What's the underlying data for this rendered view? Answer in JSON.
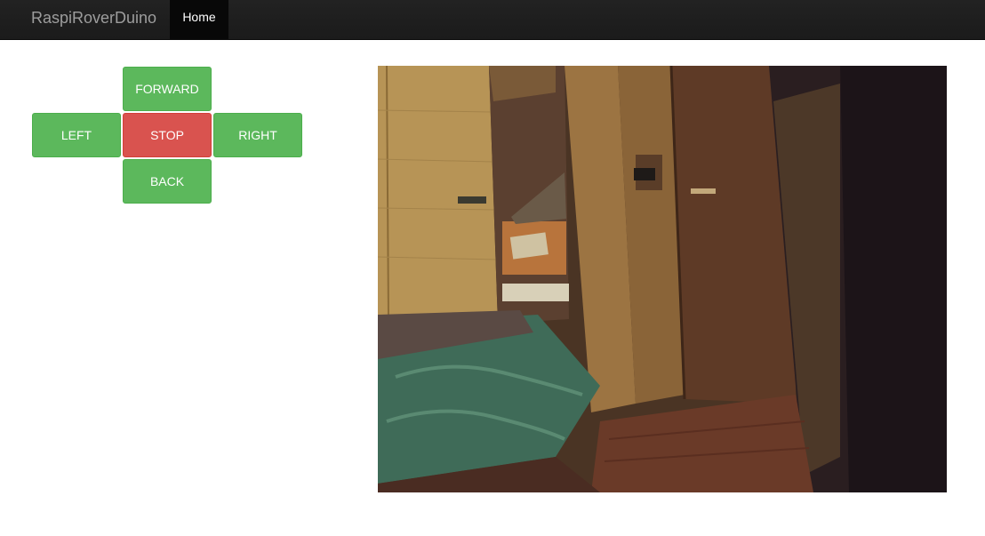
{
  "navbar": {
    "brand": "RaspiRoverDuino",
    "items": [
      {
        "label": "Home",
        "active": true
      }
    ]
  },
  "controls": {
    "forward_label": "FORWARD",
    "left_label": "LEFT",
    "stop_label": "STOP",
    "right_label": "RIGHT",
    "back_label": "BACK"
  },
  "colors": {
    "navbar_bg": "#222222",
    "active_nav_bg": "#080808",
    "direction_button": "#5cb85c",
    "stop_button": "#d9534f"
  },
  "camera": {
    "icon": "camera-stream"
  }
}
